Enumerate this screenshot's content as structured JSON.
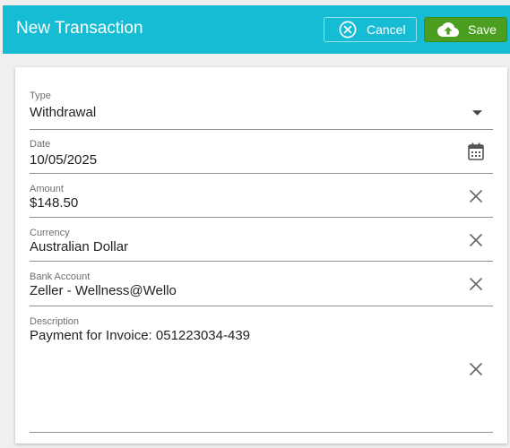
{
  "header": {
    "title": "New Transaction",
    "cancel_label": "Cancel",
    "save_label": "Save",
    "color": "#16bcd4",
    "save_color": "#4b9e1f"
  },
  "form": {
    "type": {
      "label": "Type",
      "value": "Withdrawal",
      "icon": "dropdown-arrow-icon"
    },
    "date": {
      "label": "Date",
      "value": "10/05/2025",
      "icon": "calendar-icon"
    },
    "amount": {
      "label": "Amount",
      "value": "$148.50",
      "icon": "clear-icon"
    },
    "currency": {
      "label": "Currency",
      "value": "Australian Dollar",
      "icon": "clear-icon"
    },
    "bank_account": {
      "label": "Bank Account",
      "value": "Zeller - Wellness@Wello",
      "icon": "clear-icon"
    },
    "description": {
      "label": "Description",
      "value": "Payment for Invoice: 051223034-439",
      "icon": "clear-icon"
    }
  }
}
